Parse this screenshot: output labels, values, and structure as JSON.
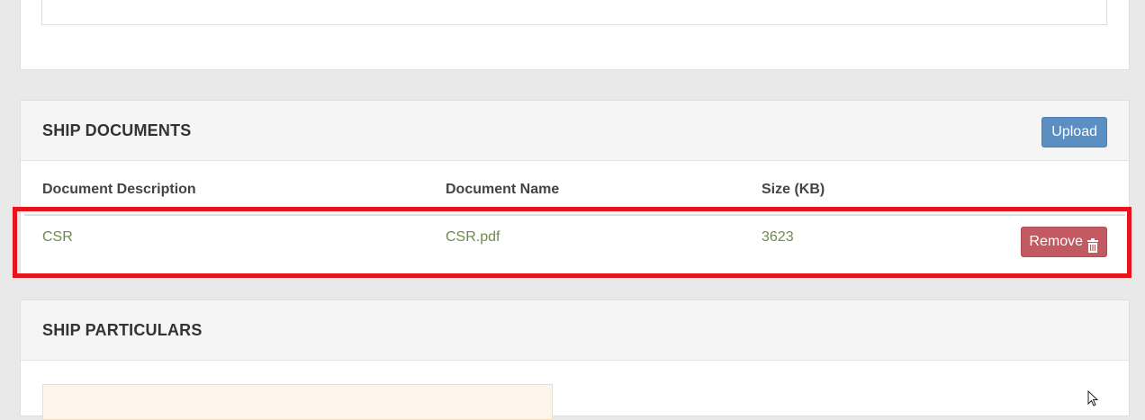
{
  "ship_documents": {
    "title": "SHIP DOCUMENTS",
    "upload_label": "Upload",
    "columns": {
      "description": "Document Description",
      "name": "Document Name",
      "size": "Size (KB)"
    },
    "rows": [
      {
        "description": "CSR",
        "name": "CSR.pdf",
        "size": "3623",
        "remove_label": "Remove"
      }
    ]
  },
  "ship_particulars": {
    "title": "SHIP PARTICULARS"
  },
  "colors": {
    "upload_button": "#5b8fc4",
    "remove_button": "#c25a62",
    "row_text": "#6d8a4f",
    "highlight": "#e8131b"
  },
  "icons": {
    "remove": "trash-icon",
    "cursor": "mouse-pointer-icon"
  }
}
